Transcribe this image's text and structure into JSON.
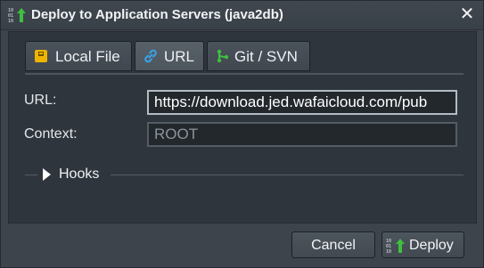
{
  "window": {
    "title": "Deploy to Application Servers (java2db)",
    "close_glyph": "✕"
  },
  "tabs": [
    {
      "label": "Local File",
      "icon": "archive-icon",
      "active": false
    },
    {
      "label": "URL",
      "icon": "link-icon",
      "active": true
    },
    {
      "label": "Git / SVN",
      "icon": "git-branch-icon",
      "active": false
    }
  ],
  "form": {
    "url_label": "URL:",
    "url_value": "https://download.jed.wafaicloud.com/pub",
    "context_label": "Context:",
    "context_value": "ROOT"
  },
  "hooks": {
    "label": "Hooks",
    "expanded": false
  },
  "buttons": {
    "cancel": "Cancel",
    "deploy": "Deploy"
  },
  "colors": {
    "accent_green": "#3fbf3f",
    "link_blue": "#3aa3e8",
    "archive_yellow": "#f0b400"
  }
}
